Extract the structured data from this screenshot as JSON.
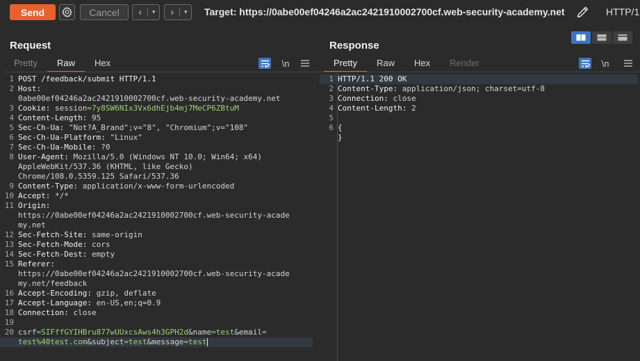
{
  "toolbar": {
    "send_label": "Send",
    "settings_icon": "gear-icon",
    "cancel_label": "Cancel",
    "back_icon": "chevron-left-icon",
    "forward_icon": "chevron-right-icon",
    "dropdown_icon": "chevron-down-icon",
    "target_text": "Target: https://0abe00ef04246a2ac2421910002700cf.web-security-academy.net",
    "edit_icon": "pencil-icon",
    "protocol_label": "HTTP/1"
  },
  "colors": {
    "accent": "#e8612c",
    "active_blue": "#3b74c4",
    "param_green": "#9fd27a"
  },
  "request": {
    "title": "Request",
    "tabs": [
      {
        "label": "Pretty",
        "active": false
      },
      {
        "label": "Raw",
        "active": true
      },
      {
        "label": "Hex",
        "active": false
      }
    ],
    "newline_toggle": "\\n",
    "menu_icon": "hamburger-icon",
    "lines": [
      {
        "n": "1",
        "parts": [
          {
            "t": "POST /feedback/submit HTTP/1.1",
            "c": "hdr"
          }
        ]
      },
      {
        "n": "2",
        "parts": [
          {
            "t": "Host:",
            "c": "hdr"
          }
        ]
      },
      {
        "n": "",
        "parts": [
          {
            "t": "0abe00ef04246a2ac2421910002700cf.web-security-academy.net",
            "c": "val"
          }
        ]
      },
      {
        "n": "3",
        "parts": [
          {
            "t": "Cookie: ",
            "c": "hdr"
          },
          {
            "t": "session",
            "c": "val"
          },
          {
            "t": "=7y8SW6NIx3Vx6dhEjb4mj7MeCP6ZBtuM",
            "c": "grn"
          }
        ]
      },
      {
        "n": "4",
        "parts": [
          {
            "t": "Content-Length: ",
            "c": "hdr"
          },
          {
            "t": "95",
            "c": "val"
          }
        ]
      },
      {
        "n": "5",
        "parts": [
          {
            "t": "Sec-Ch-Ua: ",
            "c": "hdr"
          },
          {
            "t": "\"Not?A_Brand\";v=\"8\", \"Chromium\";v=\"108\"",
            "c": "val"
          }
        ]
      },
      {
        "n": "6",
        "parts": [
          {
            "t": "Sec-Ch-Ua-Platform: ",
            "c": "hdr"
          },
          {
            "t": "\"Linux\"",
            "c": "val"
          }
        ]
      },
      {
        "n": "7",
        "parts": [
          {
            "t": "Sec-Ch-Ua-Mobile: ",
            "c": "hdr"
          },
          {
            "t": "?0",
            "c": "val"
          }
        ]
      },
      {
        "n": "8",
        "parts": [
          {
            "t": "User-Agent: ",
            "c": "hdr"
          },
          {
            "t": "Mozilla/5.0 (Windows NT 10.0; Win64; x64)",
            "c": "val"
          }
        ]
      },
      {
        "n": "",
        "parts": [
          {
            "t": "AppleWebKit/537.36 (KHTML, like Gecko)",
            "c": "val"
          }
        ]
      },
      {
        "n": "",
        "parts": [
          {
            "t": "Chrome/108.0.5359.125 Safari/537.36",
            "c": "val"
          }
        ]
      },
      {
        "n": "9",
        "parts": [
          {
            "t": "Content-Type: ",
            "c": "hdr"
          },
          {
            "t": "application/x-www-form-urlencoded",
            "c": "val"
          }
        ]
      },
      {
        "n": "10",
        "parts": [
          {
            "t": "Accept: ",
            "c": "hdr"
          },
          {
            "t": "*/*",
            "c": "val"
          }
        ]
      },
      {
        "n": "11",
        "parts": [
          {
            "t": "Origin:",
            "c": "hdr"
          }
        ]
      },
      {
        "n": "",
        "parts": [
          {
            "t": "https://0abe00ef04246a2ac2421910002700cf.web-security-acade",
            "c": "val"
          }
        ]
      },
      {
        "n": "",
        "parts": [
          {
            "t": "my.net",
            "c": "val"
          }
        ]
      },
      {
        "n": "12",
        "parts": [
          {
            "t": "Sec-Fetch-Site: ",
            "c": "hdr"
          },
          {
            "t": "same-origin",
            "c": "val"
          }
        ]
      },
      {
        "n": "13",
        "parts": [
          {
            "t": "Sec-Fetch-Mode: ",
            "c": "hdr"
          },
          {
            "t": "cors",
            "c": "val"
          }
        ]
      },
      {
        "n": "14",
        "parts": [
          {
            "t": "Sec-Fetch-Dest: ",
            "c": "hdr"
          },
          {
            "t": "empty",
            "c": "val"
          }
        ]
      },
      {
        "n": "15",
        "parts": [
          {
            "t": "Referer:",
            "c": "hdr"
          }
        ]
      },
      {
        "n": "",
        "parts": [
          {
            "t": "https://0abe00ef04246a2ac2421910002700cf.web-security-acade",
            "c": "val"
          }
        ]
      },
      {
        "n": "",
        "parts": [
          {
            "t": "my.net/feedback",
            "c": "val"
          }
        ]
      },
      {
        "n": "16",
        "parts": [
          {
            "t": "Accept-Encoding: ",
            "c": "hdr"
          },
          {
            "t": "gzip, deflate",
            "c": "val"
          }
        ]
      },
      {
        "n": "17",
        "parts": [
          {
            "t": "Accept-Language: ",
            "c": "hdr"
          },
          {
            "t": "en-US,en;q=0.9",
            "c": "val"
          }
        ]
      },
      {
        "n": "18",
        "parts": [
          {
            "t": "Connection: ",
            "c": "hdr"
          },
          {
            "t": "close",
            "c": "val"
          }
        ]
      },
      {
        "n": "19",
        "parts": []
      },
      {
        "n": "20",
        "parts": [
          {
            "t": "csrf",
            "c": "val"
          },
          {
            "t": "=SIFffGYIHBru877wUUxcsAws4h3GPH2d",
            "c": "grn"
          },
          {
            "t": "&name",
            "c": "val"
          },
          {
            "t": "=test",
            "c": "grn"
          },
          {
            "t": "&email",
            "c": "val"
          },
          {
            "t": "=",
            "c": "grn"
          }
        ]
      },
      {
        "n": "",
        "cur": true,
        "parts": [
          {
            "t": "test%40test.com",
            "c": "grn"
          },
          {
            "t": "&subject",
            "c": "val"
          },
          {
            "t": "=test",
            "c": "grn"
          },
          {
            "t": "&message",
            "c": "val"
          },
          {
            "t": "=test",
            "c": "grn"
          }
        ]
      }
    ]
  },
  "response": {
    "title": "Response",
    "tabs": [
      {
        "label": "Pretty",
        "active": true
      },
      {
        "label": "Raw",
        "active": false
      },
      {
        "label": "Hex",
        "active": false
      },
      {
        "label": "Render",
        "active": false
      }
    ],
    "newline_toggle": "\\n",
    "menu_icon": "hamburger-icon",
    "lines": [
      {
        "n": "1",
        "cur": true,
        "parts": [
          {
            "t": "HTTP/1.1 200 OK",
            "c": "hdr"
          }
        ]
      },
      {
        "n": "2",
        "parts": [
          {
            "t": "Content-Type: ",
            "c": "hdr"
          },
          {
            "t": "application/json; charset=utf-8",
            "c": "val"
          }
        ]
      },
      {
        "n": "3",
        "parts": [
          {
            "t": "Connection: ",
            "c": "hdr"
          },
          {
            "t": "close",
            "c": "val"
          }
        ]
      },
      {
        "n": "4",
        "parts": [
          {
            "t": "Content-Length: ",
            "c": "hdr"
          },
          {
            "t": "2",
            "c": "val"
          }
        ]
      },
      {
        "n": "5",
        "parts": []
      },
      {
        "n": "6",
        "parts": [
          {
            "t": "{",
            "c": "hdr"
          }
        ]
      },
      {
        "n": "",
        "parts": [
          {
            "t": "}",
            "c": "hdr"
          }
        ]
      }
    ]
  },
  "layout_toggle": {
    "options": [
      {
        "icon": "split-vertical-icon",
        "active": true
      },
      {
        "icon": "split-horizontal-icon",
        "active": false
      },
      {
        "icon": "tabs-layout-icon",
        "active": false
      }
    ]
  }
}
